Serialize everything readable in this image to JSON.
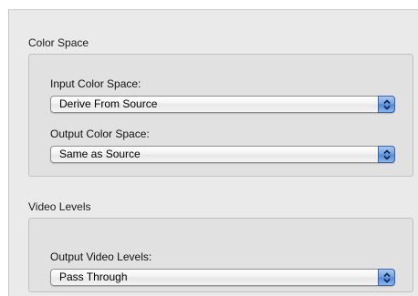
{
  "color_space": {
    "title": "Color Space",
    "input": {
      "label": "Input Color Space:",
      "value": "Derive From Source"
    },
    "output": {
      "label": "Output Color Space:",
      "value": "Same as Source"
    }
  },
  "video_levels": {
    "title": "Video Levels",
    "output": {
      "label": "Output Video Levels:",
      "value": "Pass Through"
    }
  },
  "icons": {
    "popup_arrow": "up-down-chevrons-icon"
  },
  "colors": {
    "accent": "#5b8edb",
    "panel_background": "#eaeaea",
    "group_background": "#e1e1e1"
  }
}
